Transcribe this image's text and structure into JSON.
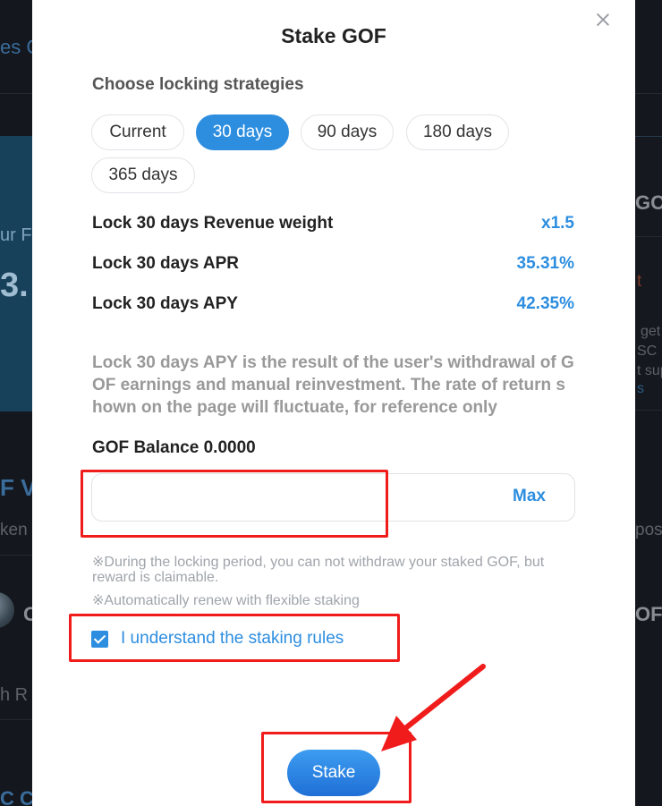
{
  "background": {
    "texts": [
      "es C",
      "ur F",
      "3.",
      "F VI",
      "ken",
      "h R",
      "C Ca",
      "GO",
      "get",
      "SC ,",
      "t sup",
      "s",
      "OF",
      "posit",
      "t",
      "C"
    ]
  },
  "modal": {
    "title": "Stake GOF",
    "strategy_heading": "Choose locking strategies",
    "strategies": [
      {
        "label": "Current",
        "active": false
      },
      {
        "label": "30 days",
        "active": true
      },
      {
        "label": "90 days",
        "active": false
      },
      {
        "label": "180 days",
        "active": false
      },
      {
        "label": "365 days",
        "active": false
      }
    ],
    "stats": [
      {
        "label": "Lock 30 days Revenue weight",
        "value": "x1.5"
      },
      {
        "label": "Lock 30 days APR",
        "value": "35.31%"
      },
      {
        "label": "Lock 30 days APY",
        "value": "42.35%"
      }
    ],
    "apy_note": "Lock 30 days APY is the result of the user's withdrawal of GOF earnings and manual reinvestment. The rate of return shown on the page will fluctuate, for reference only",
    "balance_label": "GOF Balance 0.0000",
    "amount_input": {
      "value": "",
      "placeholder": ""
    },
    "max_label": "Max",
    "tips": [
      "※During the locking period, you can not withdraw your staked GOF, but reward is claimable.",
      "※Automatically renew with flexible staking"
    ],
    "understand_label": "I understand the staking rules",
    "understand_checked": true,
    "stake_label": "Stake"
  },
  "colors": {
    "accent": "#2d8ee0",
    "annotation": "#f01c1c"
  }
}
